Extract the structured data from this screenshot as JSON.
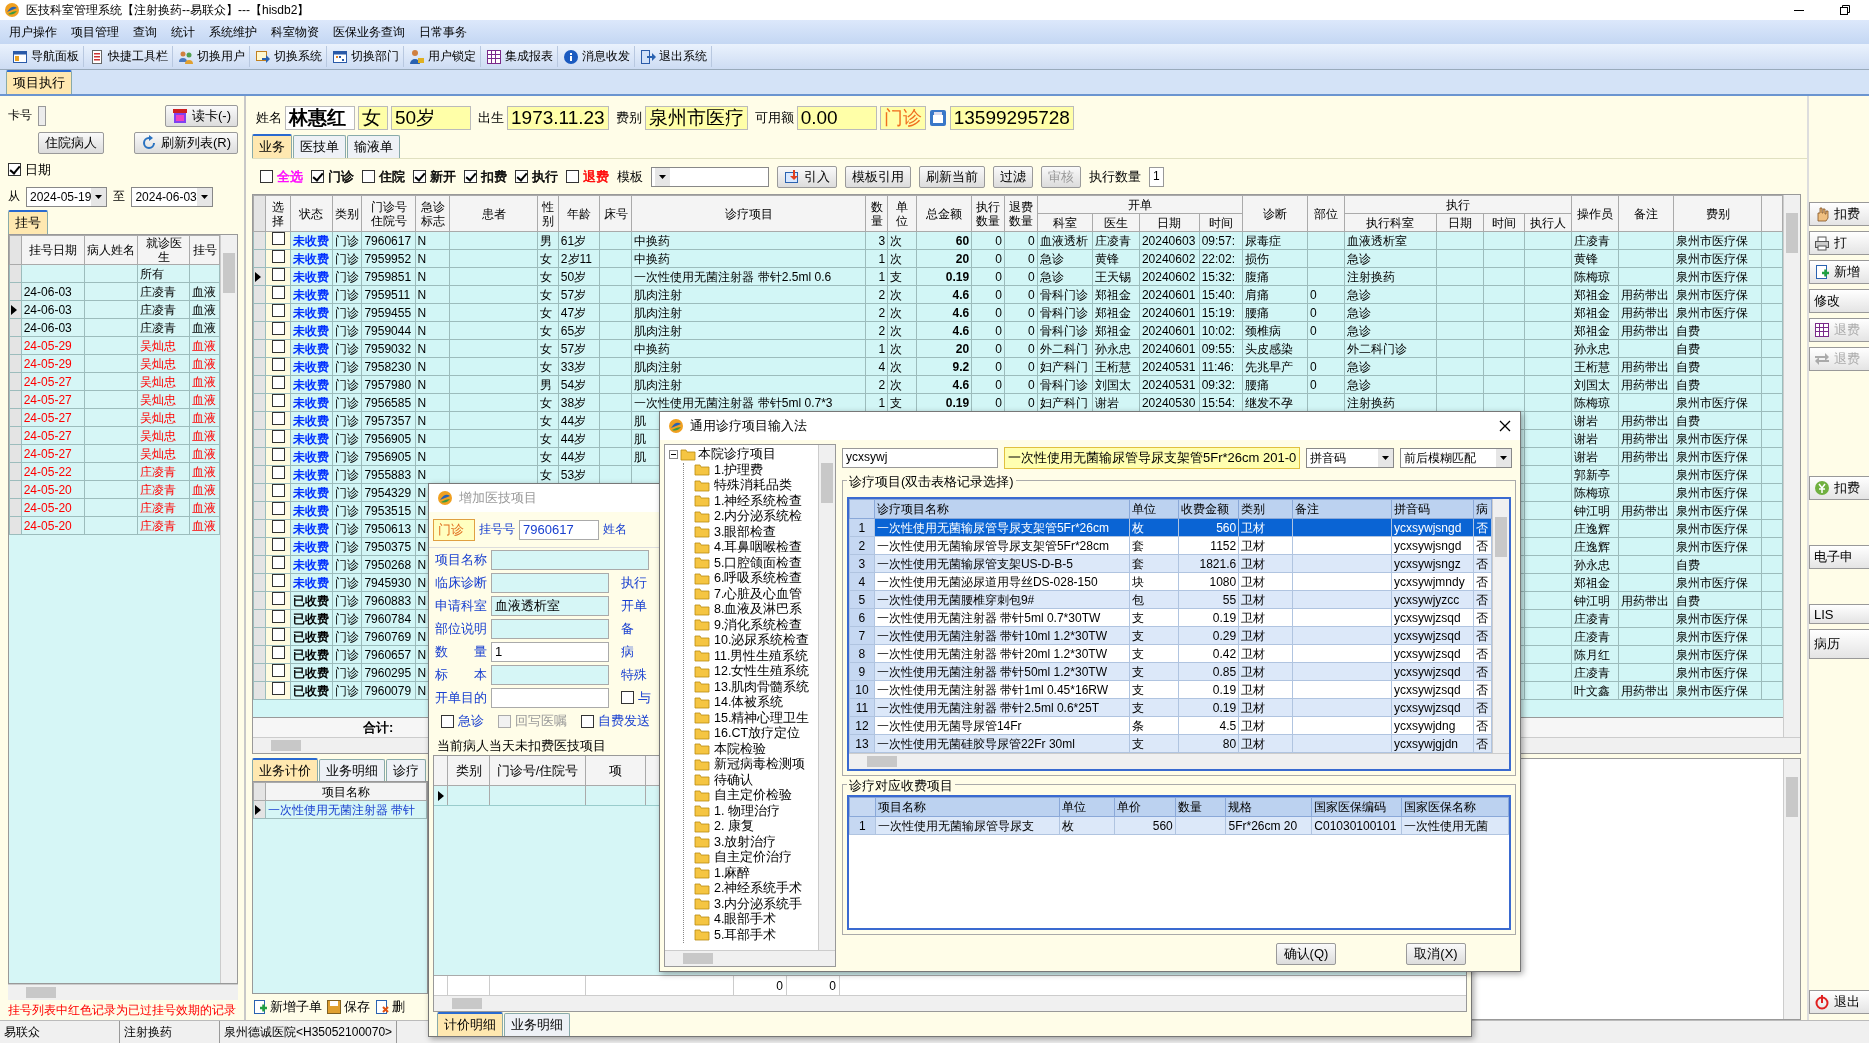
{
  "window": {
    "title": "医技科室管理系统【注射换药--易联众】---【hisdb2】"
  },
  "menu": [
    "用户操作",
    "项目管理",
    "查询",
    "统计",
    "系统维护",
    "科室物资",
    "医保业务查询",
    "日常事务"
  ],
  "toolbar": [
    "导航面板",
    "快捷工具栏",
    "切换用户",
    "切换系统",
    "切换部门",
    "用户锁定",
    "集成报表",
    "消息收发",
    "退出系统"
  ],
  "doc_tabs": [
    {
      "label": "项目执行",
      "selected": true
    }
  ],
  "left_panel": {
    "card_label": "卡号",
    "read_card_button": "读卡(-)",
    "inpatient_button": "住院病人",
    "refresh_button": "刷新列表(R)",
    "date_filter": {
      "label": "日期",
      "checked": true
    },
    "from_label": "从",
    "from_date": "2024-05-19",
    "to_label": "至",
    "to_date": "2024-06-03",
    "tabs": [
      {
        "label": "挂号",
        "selected": true
      }
    ],
    "columns": [
      "挂号日期",
      "病人姓名",
      "就诊医生",
      "挂号"
    ],
    "rows": [
      {
        "doctor": "所有",
        "expired": false,
        "current": false
      },
      {
        "date": "24-06-03",
        "doctor": "庄凌青",
        "dept": "血液",
        "expired": false,
        "current": false
      },
      {
        "date": "24-06-03",
        "doctor": "庄凌青",
        "dept": "血液",
        "expired": false,
        "current": true
      },
      {
        "date": "24-06-03",
        "doctor": "庄凌青",
        "dept": "血液",
        "expired": false,
        "current": false
      },
      {
        "date": "24-05-29",
        "doctor": "吴灿忠",
        "dept": "血液",
        "expired": true,
        "current": false
      },
      {
        "date": "24-05-29",
        "doctor": "吴灿忠",
        "dept": "血液",
        "expired": true,
        "current": false
      },
      {
        "date": "24-05-27",
        "doctor": "吴灿忠",
        "dept": "血液",
        "expired": true,
        "current": false
      },
      {
        "date": "24-05-27",
        "doctor": "吴灿忠",
        "dept": "血液",
        "expired": true,
        "current": false
      },
      {
        "date": "24-05-27",
        "doctor": "吴灿忠",
        "dept": "血液",
        "expired": true,
        "current": false
      },
      {
        "date": "24-05-27",
        "doctor": "吴灿忠",
        "dept": "血液",
        "expired": true,
        "current": false
      },
      {
        "date": "24-05-27",
        "doctor": "吴灿忠",
        "dept": "血液",
        "expired": true,
        "current": false
      },
      {
        "date": "24-05-22",
        "doctor": "庄凌青",
        "dept": "血液",
        "expired": true,
        "current": false
      },
      {
        "date": "24-05-20",
        "doctor": "庄凌青",
        "dept": "血液",
        "expired": true,
        "current": false
      },
      {
        "date": "24-05-20",
        "doctor": "庄凌青",
        "dept": "血液",
        "expired": true,
        "current": false
      },
      {
        "date": "24-05-20",
        "doctor": "庄凌青",
        "dept": "血液",
        "expired": true,
        "current": false
      }
    ],
    "note": "挂号列表中红色记录为已过挂号效期的记录"
  },
  "patient": {
    "name_label": "姓名",
    "name": "林惠红",
    "sex": "女",
    "age": "50岁",
    "birth_label": "出生",
    "birth": "1973.11.23",
    "fee_label": "费别",
    "fee_type": "泉州市医疗",
    "balance_label": "可用额",
    "balance": "0.00",
    "visit_type": "门诊",
    "phone": "13599295728"
  },
  "work_tabs": [
    {
      "label": "业务",
      "selected": true
    },
    {
      "label": "医技单",
      "selected": false
    },
    {
      "label": "输液单",
      "selected": false
    }
  ],
  "filters": [
    {
      "label": "全选",
      "checked": false,
      "color": "#ff00ff"
    },
    {
      "label": "门诊",
      "checked": true,
      "color": "#000000"
    },
    {
      "label": "住院",
      "checked": false,
      "color": "#000000"
    },
    {
      "label": "新开",
      "checked": true,
      "color": "#000000"
    },
    {
      "label": "扣费",
      "checked": true,
      "color": "#000000"
    },
    {
      "label": "执行",
      "checked": true,
      "color": "#000000"
    },
    {
      "label": "退费",
      "checked": false,
      "color": "#ff0000"
    }
  ],
  "template_label": "模板",
  "actions": [
    {
      "label": "引入",
      "disabled": false
    },
    {
      "label": "模板引用",
      "disabled": false
    },
    {
      "label": "刷新当前",
      "disabled": false
    },
    {
      "label": "过滤",
      "disabled": false
    },
    {
      "label": "审核",
      "disabled": true
    }
  ],
  "exec_count_label": "执行数量",
  "exec_count": "1",
  "main_table": {
    "columns": [
      {
        "label": "选择"
      },
      {
        "label": "状态"
      },
      {
        "label": "类别"
      },
      {
        "label": "门诊号住院号"
      },
      {
        "label": "急诊标志"
      },
      {
        "label": "患者"
      },
      {
        "label": "性别"
      },
      {
        "label": "年龄"
      },
      {
        "label": "床号"
      },
      {
        "label": "诊疗项目"
      },
      {
        "label": "数量"
      },
      {
        "label": "单位"
      },
      {
        "label": "总金额"
      },
      {
        "label": "执行数量"
      },
      {
        "label": "退费数量"
      },
      {
        "label": "开单",
        "children": [
          {
            "label": "科室"
          },
          {
            "label": "医生"
          },
          {
            "label": "日期"
          },
          {
            "label": "时间"
          }
        ]
      },
      {
        "label": "诊断"
      },
      {
        "label": "部位"
      },
      {
        "label": "执行",
        "children": [
          {
            "label": "执行科室"
          },
          {
            "label": "日期"
          },
          {
            "label": "时间"
          },
          {
            "label": "执行人"
          }
        ]
      },
      {
        "label": "操作员"
      },
      {
        "label": "备注"
      },
      {
        "label": "费别"
      }
    ],
    "rows": [
      {
        "checked": false,
        "current": false,
        "paid": false,
        "status": "未收费",
        "type": "门诊",
        "no": "7960617",
        "urgent": "N",
        "sex": "男",
        "age": "61岁",
        "item": "中换药",
        "qty": "3",
        "unit": "次",
        "total": "60",
        "exec_qty": "0",
        "refund_qty": "0",
        "dept": "血液透析",
        "doctor": "庄凌青",
        "date": "20240603",
        "time": "09:57:",
        "diagnosis": "尿毒症",
        "exec_dept": "血液透析室",
        "operator": "庄凌青",
        "fee_type": "泉州市医疗保"
      },
      {
        "checked": false,
        "current": false,
        "paid": false,
        "status": "未收费",
        "type": "门诊",
        "no": "7959952",
        "urgent": "N",
        "sex": "女",
        "age": "2岁11",
        "item": "中换药",
        "qty": "1",
        "unit": "次",
        "total": "20",
        "exec_qty": "0",
        "refund_qty": "0",
        "dept": "急诊",
        "doctor": "黄锋",
        "date": "20240602",
        "time": "22:02:",
        "diagnosis": "损伤",
        "exec_dept": "急诊",
        "operator": "黄锋",
        "fee_type": "泉州市医疗保"
      },
      {
        "checked": false,
        "current": true,
        "paid": false,
        "status": "未收费",
        "type": "门诊",
        "no": "7959851",
        "urgent": "N",
        "sex": "女",
        "age": "50岁",
        "item": "一次性使用无菌注射器 带针2.5ml 0.6",
        "qty": "1",
        "unit": "支",
        "total": "0.19",
        "exec_qty": "0",
        "refund_qty": "0",
        "dept": "急诊",
        "doctor": "王天锡",
        "date": "20240602",
        "time": "15:32:",
        "diagnosis": "腹痛",
        "exec_dept": "注射换药",
        "operator": "陈梅琼",
        "fee_type": "泉州市医疗保"
      },
      {
        "checked": false,
        "current": false,
        "paid": false,
        "status": "未收费",
        "type": "门诊",
        "no": "7959511",
        "urgent": "N",
        "sex": "女",
        "age": "57岁",
        "item": "肌肉注射",
        "qty": "2",
        "unit": "次",
        "total": "4.6",
        "exec_qty": "0",
        "refund_qty": "0",
        "dept": "骨科门诊",
        "doctor": "郑祖金",
        "date": "20240601",
        "time": "15:40:",
        "diagnosis": "肩痛",
        "site": "0",
        "exec_dept": "急诊",
        "operator": "郑祖金",
        "remark": "用药带出",
        "fee_type": "泉州市医疗保"
      },
      {
        "checked": false,
        "current": false,
        "paid": false,
        "status": "未收费",
        "type": "门诊",
        "no": "7959455",
        "urgent": "N",
        "sex": "女",
        "age": "47岁",
        "item": "肌肉注射",
        "qty": "2",
        "unit": "次",
        "total": "4.6",
        "exec_qty": "0",
        "refund_qty": "0",
        "dept": "骨科门诊",
        "doctor": "郑祖金",
        "date": "20240601",
        "time": "15:19:",
        "diagnosis": "腰痛",
        "site": "0",
        "exec_dept": "急诊",
        "operator": "郑祖金",
        "remark": "用药带出",
        "fee_type": "泉州市医疗保"
      },
      {
        "checked": false,
        "current": false,
        "paid": false,
        "status": "未收费",
        "type": "门诊",
        "no": "7959044",
        "urgent": "N",
        "sex": "女",
        "age": "65岁",
        "item": "肌肉注射",
        "qty": "2",
        "unit": "次",
        "total": "4.6",
        "exec_qty": "0",
        "refund_qty": "0",
        "dept": "骨科门诊",
        "doctor": "郑祖金",
        "date": "20240601",
        "time": "10:02:",
        "diagnosis": "颈椎病",
        "site": "0",
        "exec_dept": "急诊",
        "operator": "郑祖金",
        "remark": "用药带出",
        "fee_type": "自费"
      },
      {
        "checked": false,
        "current": false,
        "paid": false,
        "status": "未收费",
        "type": "门诊",
        "no": "7959032",
        "urgent": "N",
        "sex": "女",
        "age": "57岁",
        "item": "中换药",
        "qty": "1",
        "unit": "次",
        "total": "20",
        "exec_qty": "0",
        "refund_qty": "0",
        "dept": "外二科门",
        "doctor": "孙永忠",
        "date": "20240601",
        "time": "09:55:",
        "diagnosis": "头皮感染",
        "exec_dept": "外二科门诊",
        "operator": "孙永忠",
        "fee_type": "自费"
      },
      {
        "checked": false,
        "current": false,
        "paid": false,
        "status": "未收费",
        "type": "门诊",
        "no": "7958230",
        "urgent": "N",
        "sex": "女",
        "age": "33岁",
        "item": "肌肉注射",
        "qty": "4",
        "unit": "次",
        "total": "9.2",
        "exec_qty": "0",
        "refund_qty": "0",
        "dept": "妇产科门",
        "doctor": "王桁慧",
        "date": "20240531",
        "time": "11:46:",
        "diagnosis": "先兆早产",
        "site": "0",
        "exec_dept": "急诊",
        "operator": "王桁慧",
        "remark": "用药带出",
        "fee_type": "自费"
      },
      {
        "checked": false,
        "current": false,
        "paid": false,
        "status": "未收费",
        "type": "门诊",
        "no": "7957980",
        "urgent": "N",
        "sex": "男",
        "age": "54岁",
        "item": "肌肉注射",
        "qty": "2",
        "unit": "次",
        "total": "4.6",
        "exec_qty": "0",
        "refund_qty": "0",
        "dept": "骨科门诊",
        "doctor": "刘国太",
        "date": "20240531",
        "time": "09:32:",
        "diagnosis": "腰痛",
        "site": "0",
        "exec_dept": "急诊",
        "operator": "刘国太",
        "remark": "用药带出",
        "fee_type": "自费"
      },
      {
        "checked": false,
        "current": false,
        "paid": false,
        "status": "未收费",
        "type": "门诊",
        "no": "7956585",
        "urgent": "N",
        "sex": "女",
        "age": "38岁",
        "item": "一次性使用无菌注射器 带针5ml 0.7*3",
        "qty": "1",
        "unit": "支",
        "total": "0.19",
        "exec_qty": "0",
        "refund_qty": "0",
        "dept": "妇产科门",
        "doctor": "谢岩",
        "date": "20240530",
        "time": "15:54:",
        "diagnosis": "继发不孕",
        "exec_dept": "注射换药",
        "operator": "陈梅琼",
        "fee_type": "泉州市医疗保"
      },
      {
        "checked": false,
        "current": false,
        "paid": false,
        "status": "未收费",
        "type": "门诊",
        "no": "7957357",
        "urgent": "N",
        "sex": "女",
        "age": "44岁",
        "item": "肌",
        "operator": "谢岩",
        "remark": "用药带出",
        "fee_type": "自费"
      },
      {
        "checked": false,
        "current": false,
        "paid": false,
        "status": "未收费",
        "type": "门诊",
        "no": "7956905",
        "urgent": "N",
        "sex": "女",
        "age": "44岁",
        "item": "肌",
        "operator": "谢岩",
        "remark": "用药带出",
        "fee_type": "泉州市医疗保"
      },
      {
        "checked": false,
        "current": false,
        "paid": false,
        "status": "未收费",
        "type": "门诊",
        "no": "7956905",
        "urgent": "N",
        "sex": "女",
        "age": "44岁",
        "item": "肌",
        "operator": "谢岩",
        "remark": "用药带出",
        "fee_type": "泉州市医疗保"
      },
      {
        "checked": false,
        "current": false,
        "paid": false,
        "status": "未收费",
        "type": "门诊",
        "no": "7955883",
        "urgent": "N",
        "sex": "女",
        "age": "53岁",
        "operator": "郭新亭",
        "fee_type": "泉州市医疗保"
      },
      {
        "checked": false,
        "current": false,
        "paid": false,
        "status": "未收费",
        "type": "门诊",
        "no": "7954329",
        "urgent": "N",
        "operator": "陈梅琼",
        "fee_type": "泉州市医疗保"
      },
      {
        "checked": false,
        "current": false,
        "paid": false,
        "status": "未收费",
        "type": "门诊",
        "no": "7953515",
        "urgent": "N",
        "operator": "钟江明",
        "remark": "用药带出",
        "fee_type": "泉州市医疗保"
      },
      {
        "checked": false,
        "current": false,
        "paid": false,
        "status": "未收费",
        "type": "门诊",
        "no": "7950613",
        "urgent": "N",
        "operator": "庄逸辉",
        "fee_type": "泉州市医疗保"
      },
      {
        "checked": false,
        "current": false,
        "paid": false,
        "status": "未收费",
        "type": "门诊",
        "no": "7950375",
        "urgent": "N",
        "operator": "庄逸辉",
        "fee_type": "泉州市医疗保"
      },
      {
        "checked": false,
        "current": false,
        "paid": false,
        "status": "未收费",
        "type": "门诊",
        "no": "7950268",
        "urgent": "N",
        "operator": "孙永忠",
        "fee_type": "自费"
      },
      {
        "checked": false,
        "current": false,
        "paid": false,
        "status": "未收费",
        "type": "门诊",
        "no": "7945930",
        "urgent": "N",
        "operator": "郑祖金",
        "fee_type": "泉州市医疗保"
      },
      {
        "checked": false,
        "current": false,
        "paid": true,
        "status": "已收费",
        "type": "门诊",
        "no": "7960883",
        "urgent": "N",
        "operator": "钟江明",
        "remark": "用药带出",
        "fee_type": "自费"
      },
      {
        "checked": false,
        "current": false,
        "paid": true,
        "status": "已收费",
        "type": "门诊",
        "no": "7960784",
        "urgent": "N",
        "operator": "庄凌青",
        "fee_type": "泉州市医疗保"
      },
      {
        "checked": false,
        "current": false,
        "paid": true,
        "status": "已收费",
        "type": "门诊",
        "no": "7960769",
        "urgent": "N",
        "operator": "庄凌青",
        "fee_type": "泉州市医疗保"
      },
      {
        "checked": false,
        "current": false,
        "paid": true,
        "status": "已收费",
        "type": "门诊",
        "no": "7960657",
        "urgent": "N",
        "operator": "陈月红",
        "fee_type": "泉州市医疗保"
      },
      {
        "checked": false,
        "current": false,
        "paid": true,
        "status": "已收费",
        "type": "门诊",
        "no": "7960295",
        "urgent": "N",
        "operator": "庄凌青",
        "fee_type": "泉州市医疗保"
      },
      {
        "checked": false,
        "current": false,
        "paid": true,
        "status": "已收费",
        "type": "门诊",
        "no": "7960079",
        "urgent": "N",
        "operator": "叶文鑫",
        "remark": "用药带出",
        "fee_type": "泉州市医疗保"
      }
    ],
    "total_label": "合计:"
  },
  "lower_panel": {
    "tabs": [
      {
        "label": "业务计价",
        "selected": true
      },
      {
        "label": "业务明细",
        "selected": false
      },
      {
        "label": "诊疗",
        "selected": false
      }
    ],
    "column": "项目名称",
    "rows": [
      {
        "item": "一次性使用无菌注射器 带针",
        "current": true
      }
    ],
    "buttons": [
      "新增子单",
      "保存",
      "删"
    ]
  },
  "side_buttons": [
    {
      "label": "扣费",
      "disabled": false
    },
    {
      "label": "打",
      "disabled": false
    },
    {
      "label": "新增",
      "disabled": false
    },
    {
      "label": "修改",
      "disabled": false
    },
    {
      "label": "退费",
      "disabled": true
    },
    {
      "label": "退费",
      "disabled": true
    },
    {
      "label": "扣费",
      "disabled": false
    },
    {
      "label": "电子申",
      "disabled": false
    },
    {
      "label": "LIS",
      "disabled": false
    },
    {
      "label": "病历",
      "disabled": false
    },
    {
      "label": "退出",
      "disabled": false
    }
  ],
  "status_bar": [
    "易联众",
    "注射换药",
    "泉州德诚医院<H35052100070>"
  ],
  "add_dialog": {
    "title": "增加医技项目",
    "active": false,
    "visit_type": "门诊",
    "reg_label": "挂号号",
    "reg_no": "7960617",
    "name_label": "姓名",
    "fields": [
      {
        "label": "项目名称",
        "tinted": true
      },
      {
        "label": "临床诊断",
        "tinted": true,
        "side_label": "执行"
      },
      {
        "label": "申请科室",
        "value": "血液透析室",
        "tinted": true,
        "side_label": "开单"
      },
      {
        "label": "部位说明",
        "tinted": true,
        "side_label": "备"
      },
      {
        "label": "数　　量",
        "value": "1",
        "tinted": false,
        "side_label": "病"
      },
      {
        "label": "标　　本",
        "tinted": true,
        "side_label": "特殊"
      },
      {
        "label": "开单目的",
        "tinted": false,
        "side_check": {
          "label": "与",
          "checked": false
        }
      }
    ],
    "checks": [
      {
        "label": "急诊",
        "checked": false,
        "disabled": false
      },
      {
        "label": "回写医嘱",
        "checked": false,
        "disabled": true
      },
      {
        "label": "自费发送",
        "checked": false,
        "disabled": false
      }
    ],
    "group_title": "当前病人当天未扣费医技项目",
    "columns": [
      "类别",
      "门诊号/住院号",
      "项"
    ],
    "totals": [
      "0",
      "0"
    ],
    "tabs": [
      {
        "label": "计价明细",
        "selected": true
      },
      {
        "label": "业务明细",
        "selected": false
      }
    ]
  },
  "picker_dialog": {
    "title": "通用诊疗项目输入法",
    "tree": {
      "label": "本院诊疗项目",
      "expanded": true,
      "children": [
        {
          "label": "1.护理费"
        },
        {
          "label": "特殊消耗品类"
        },
        {
          "label": "1.神经系统检查"
        },
        {
          "label": "2.内分泌系统检"
        },
        {
          "label": "3.眼部检查"
        },
        {
          "label": "4.耳鼻咽喉检查"
        },
        {
          "label": "5.口腔颌面检查"
        },
        {
          "label": "6.呼吸系统检查"
        },
        {
          "label": "7.心脏及心血管"
        },
        {
          "label": "8.血液及淋巴系"
        },
        {
          "label": "9.消化系统检查"
        },
        {
          "label": "10.泌尿系统检查"
        },
        {
          "label": "11.男性生殖系统"
        },
        {
          "label": "12.女性生殖系统"
        },
        {
          "label": "13.肌肉骨髓系统"
        },
        {
          "label": "14.体被系统"
        },
        {
          "label": "15.精神心理卫生"
        },
        {
          "label": "16.CT放疗定位"
        },
        {
          "label": "本院检验"
        },
        {
          "label": "新冠病毒检测项"
        },
        {
          "label": "待确认"
        },
        {
          "label": "自主定价检验"
        },
        {
          "label": "1. 物理治疗"
        },
        {
          "label": "2. 康复"
        },
        {
          "label": "3.放射治疗"
        },
        {
          "label": "自主定价治疗"
        },
        {
          "label": "1.麻醉"
        },
        {
          "label": "2.神经系统手术"
        },
        {
          "label": "3.内分泌系统手"
        },
        {
          "label": "4.眼部手术"
        },
        {
          "label": "5.耳部手术"
        }
      ]
    },
    "search": "ycxsywj",
    "preview": "一次性使用无菌输尿管导尿支架管5Fr*26cm 201-0",
    "match_field": "拼音码",
    "match_mode": "前后模糊匹配",
    "items_title": "诊疗项目(双击表格记录选择)",
    "items_columns": [
      "诊疗项目名称",
      "单位",
      "收费金额",
      "类别",
      "备注",
      "拼音码",
      "病"
    ],
    "items": [
      {
        "no": "1",
        "name": "一次性使用无菌输尿管导尿支架管5Fr*26cm",
        "unit": "枚",
        "price": "560",
        "category": "卫材",
        "pinyin": "ycxsywjsngd",
        "flag": "否",
        "selected": true
      },
      {
        "no": "2",
        "name": "一次性使用无菌输尿管导尿支架管5Fr*28cm",
        "unit": "套",
        "price": "1152",
        "category": "卫材",
        "pinyin": "ycxsywjsngd",
        "flag": "否",
        "selected": false
      },
      {
        "no": "3",
        "name": "一次性使用无菌输尿管支架US-D-B-5",
        "unit": "套",
        "price": "1821.6",
        "category": "卫材",
        "pinyin": "ycxsywjsngz",
        "flag": "否",
        "selected": false
      },
      {
        "no": "4",
        "name": "一次性使用无菌泌尿道用导丝DS-028-150",
        "unit": "块",
        "price": "1080",
        "category": "卫材",
        "pinyin": "ycxsywjmndy",
        "flag": "否",
        "selected": false
      },
      {
        "no": "5",
        "name": "一次性使用无菌腰椎穿刺包9#",
        "unit": "包",
        "price": "55",
        "category": "卫材",
        "pinyin": "ycxsywjyzcc",
        "flag": "否",
        "selected": false
      },
      {
        "no": "6",
        "name": "一次性使用无菌注射器 带针5ml 0.7*30TW",
        "unit": "支",
        "price": "0.19",
        "category": "卫材",
        "pinyin": "ycxsywjzsqd",
        "flag": "否",
        "selected": false
      },
      {
        "no": "7",
        "name": "一次性使用无菌注射器 带针10ml 1.2*30TW",
        "unit": "支",
        "price": "0.29",
        "category": "卫材",
        "pinyin": "ycxsywjzsqd",
        "flag": "否",
        "selected": false
      },
      {
        "no": "8",
        "name": "一次性使用无菌注射器 带针20ml 1.2*30TW",
        "unit": "支",
        "price": "0.42",
        "category": "卫材",
        "pinyin": "ycxsywjzsqd",
        "flag": "否",
        "selected": false
      },
      {
        "no": "9",
        "name": "一次性使用无菌注射器 带针50ml 1.2*30TW",
        "unit": "支",
        "price": "0.85",
        "category": "卫材",
        "pinyin": "ycxsywjzsqd",
        "flag": "否",
        "selected": false
      },
      {
        "no": "10",
        "name": "一次性使用无菌注射器 带针1ml 0.45*16RW",
        "unit": "支",
        "price": "0.19",
        "category": "卫材",
        "pinyin": "ycxsywjzsqd",
        "flag": "否",
        "selected": false
      },
      {
        "no": "11",
        "name": "一次性使用无菌注射器 带针2.5ml 0.6*25T",
        "unit": "支",
        "price": "0.19",
        "category": "卫材",
        "pinyin": "ycxsywjzsqd",
        "flag": "否",
        "selected": false
      },
      {
        "no": "12",
        "name": "一次性使用无菌导尿管14Fr",
        "unit": "条",
        "price": "4.5",
        "category": "卫材",
        "pinyin": "ycxsywjdng",
        "flag": "否",
        "selected": false
      },
      {
        "no": "13",
        "name": "一次性使用无菌硅胶导尿管22Fr  30ml",
        "unit": "支",
        "price": "80",
        "category": "卫材",
        "pinyin": "ycxsywjgjdn",
        "flag": "否",
        "selected": false
      }
    ],
    "fees_title": "诊疗对应收费项目",
    "fees_columns": [
      "项目名称",
      "单位",
      "单价",
      "数量",
      "规格",
      "国家医保编码",
      "国家医保名称"
    ],
    "fees": [
      {
        "no": "1",
        "name": "一次性使用无菌输尿管导尿支",
        "unit": "枚",
        "price": "560",
        "spec": "5Fr*26cm 20",
        "code": "C01030100101",
        "insurance_name": "一次性使用无菌"
      }
    ],
    "buttons": [
      "确认(Q)",
      "取消(X)"
    ]
  }
}
